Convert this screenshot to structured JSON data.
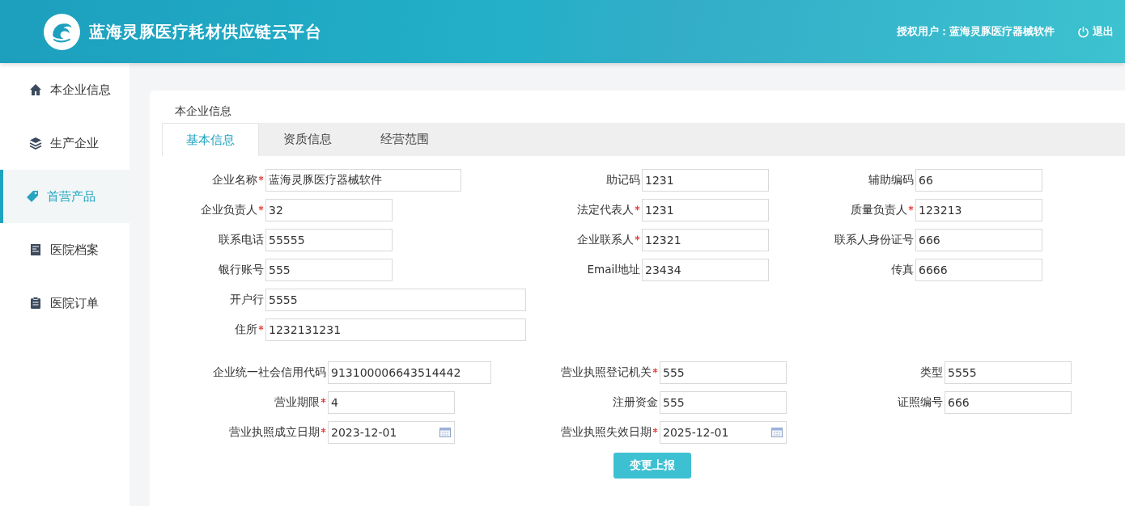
{
  "header": {
    "title": "蓝海灵豚医疗耗材供应链云平台",
    "user": "授权用户：蓝海灵豚医疗器械软件",
    "logout": "退出"
  },
  "sidebar": {
    "items": [
      {
        "label": "本企业信息",
        "selected": false
      },
      {
        "label": "生产企业",
        "selected": false
      },
      {
        "label": "首营产品",
        "selected": true
      },
      {
        "label": "医院档案",
        "selected": false
      },
      {
        "label": "医院订单",
        "selected": false
      }
    ]
  },
  "card": {
    "title": "本企业信息",
    "tabs": [
      {
        "label": "基本信息",
        "selected": true
      },
      {
        "label": "资质信息",
        "selected": false
      },
      {
        "label": "经营范围",
        "selected": false
      }
    ],
    "sections": [
      {
        "rows": [
          [
            {
              "label": "企业名称",
              "required": true,
              "value": "蓝海灵豚医疗器械软件",
              "kind": "text"
            },
            {
              "label": "助记码",
              "required": false,
              "value": "1231",
              "kind": "text"
            },
            {
              "label": "辅助编码",
              "required": false,
              "value": "66",
              "kind": "text"
            }
          ],
          [
            {
              "label": "企业负责人",
              "required": true,
              "value": "32",
              "kind": "text"
            },
            {
              "label": "法定代表人",
              "required": true,
              "value": "1231",
              "kind": "text"
            },
            {
              "label": "质量负责人",
              "required": true,
              "value": "123213",
              "kind": "text"
            }
          ],
          [
            {
              "label": "联系电话",
              "required": false,
              "value": "55555",
              "kind": "text"
            },
            {
              "label": "企业联系人",
              "required": true,
              "value": "12321",
              "kind": "text"
            },
            {
              "label": "联系人身份证号",
              "required": false,
              "value": "666",
              "kind": "text"
            }
          ],
          [
            {
              "label": "银行账号",
              "required": false,
              "value": "555",
              "kind": "text"
            },
            {
              "label": "Email地址",
              "required": false,
              "value": "23434",
              "kind": "text"
            },
            {
              "label": "传真",
              "required": false,
              "value": "6666",
              "kind": "text"
            }
          ],
          [
            {
              "label": "开户行",
              "required": false,
              "value": "5555",
              "kind": "text"
            }
          ],
          [
            {
              "label": "住所",
              "required": true,
              "value": "1232131231",
              "kind": "text"
            }
          ]
        ]
      },
      {
        "rows": [
          [
            {
              "label": "企业统一社会信用代码",
              "required": false,
              "value": "913100006643514442",
              "kind": "text"
            },
            {
              "label": "营业执照登记机关",
              "required": true,
              "value": "555",
              "kind": "text"
            },
            {
              "label": "类型",
              "required": false,
              "value": "5555",
              "kind": "text"
            }
          ],
          [
            {
              "label": "营业期限",
              "required": true,
              "value": "4",
              "kind": "text"
            },
            {
              "label": "注册资金",
              "required": false,
              "value": "555",
              "kind": "text"
            },
            {
              "label": "证照编号",
              "required": false,
              "value": "666",
              "kind": "text"
            }
          ],
          [
            {
              "label": "营业执照成立日期",
              "required": true,
              "value": "2023-12-01",
              "kind": "date"
            },
            {
              "label": "营业执照失效日期",
              "required": true,
              "value": "2025-12-01",
              "kind": "date"
            }
          ]
        ]
      }
    ],
    "submit": "变更上报"
  }
}
